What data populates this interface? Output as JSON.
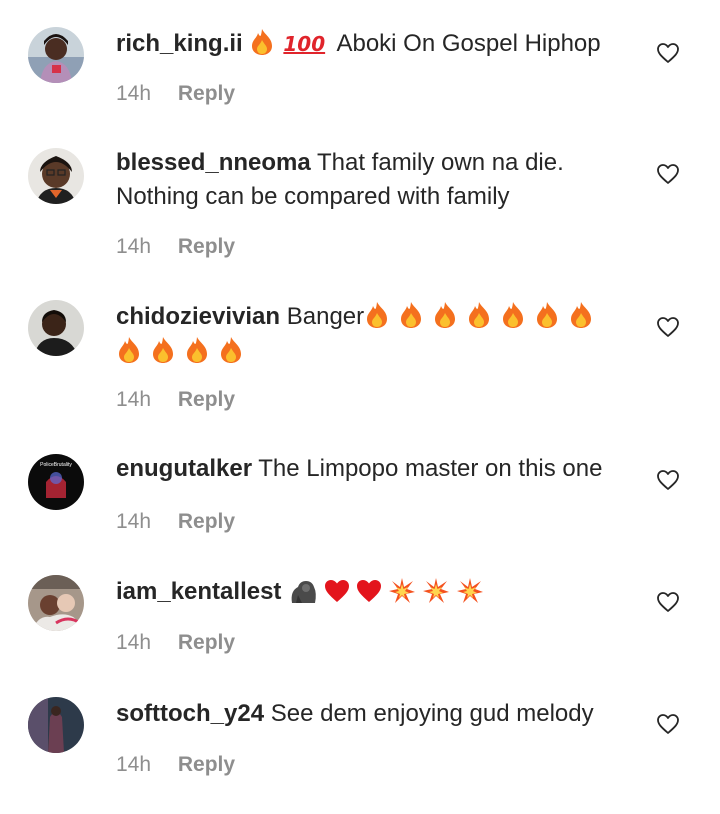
{
  "comments": [
    {
      "username": "rich_king.ii",
      "text": "Aboki On Gospel Hiphop",
      "emojis_before_text": [
        "fire",
        "hundred-points"
      ],
      "time": "14h",
      "reply_label": "Reply"
    },
    {
      "username": "blessed_nneoma",
      "text": "That family own na die. Nothing can be compared with family",
      "time": "14h",
      "reply_label": "Reply"
    },
    {
      "username": "chidozievivian",
      "text": "Banger",
      "emojis_after_text": [
        "fire",
        "fire",
        "fire",
        "fire",
        "fire",
        "fire",
        "fire",
        "fire",
        "fire",
        "fire",
        "fire"
      ],
      "time": "14h",
      "reply_label": "Reply"
    },
    {
      "username": "enugutalker",
      "text": "The Limpopo master on this one",
      "time": "14h",
      "reply_label": "Reply"
    },
    {
      "username": "iam_kentallest",
      "text": "",
      "emojis_after_text": [
        "gorilla",
        "red-heart",
        "red-heart",
        "collision",
        "collision",
        "collision"
      ],
      "time": "14h",
      "reply_label": "Reply"
    },
    {
      "username": "softtoch_y24",
      "text": "See dem enjoying gud melody",
      "time": "14h",
      "reply_label": "Reply"
    }
  ],
  "avatar_overlay_text": "PoliceBrutality",
  "icons": {
    "like": "heart-outline-icon"
  },
  "colors": {
    "text": "#262626",
    "meta": "#8e8e8e",
    "background": "#ffffff"
  }
}
